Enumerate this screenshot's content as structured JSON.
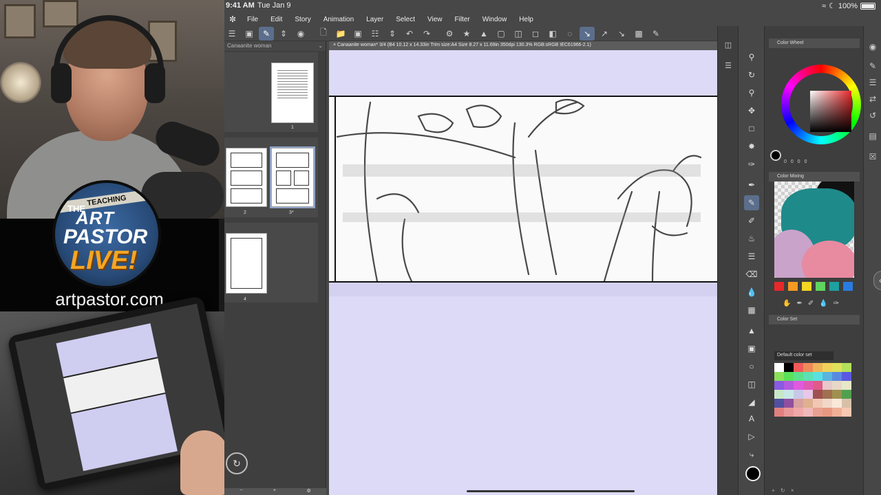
{
  "promo": {
    "logo_top": "TEACHING",
    "logo_line1": "THE",
    "logo_line2": "ART",
    "logo_line3": "PASTOR",
    "logo_line4": "LIVE!",
    "url": "artpastor.com"
  },
  "status_bar": {
    "time": "9:41 AM",
    "date": "Tue Jan 9",
    "wifi_icon": "wifi-icon",
    "battery": "100%"
  },
  "menu": {
    "items": [
      "File",
      "Edit",
      "Story",
      "Animation",
      "Layer",
      "Select",
      "View",
      "Filter",
      "Window",
      "Help"
    ]
  },
  "page_manager": {
    "title": "Canaanite woman",
    "pages": [
      {
        "label": "1"
      },
      {
        "label": "2"
      },
      {
        "label": "3*"
      },
      {
        "label": "4"
      }
    ]
  },
  "canvas": {
    "tab_title": "× Canaanite woman* 3/4 (B4 10.12 x 14.33in Trim size:A4 Size 8.27 x 11.69in 350dpi 130.3% RGB:sRGB IEC61966-2.1)"
  },
  "panels": {
    "color_wheel_title": "Color Wheel",
    "color_wheel_values": "0 0 0 0",
    "color_mixing_title": "Color Mixing",
    "color_set_title": "Color Set",
    "color_set_selected": "Default color set"
  },
  "colors": {
    "accent": "#5b6e8c",
    "canvas_bg": "#dcdaf7",
    "mix_swatches": [
      "#e8282a",
      "#f59a23",
      "#f5d623",
      "#5fd45f",
      "#1fa0a0",
      "#2a7be0"
    ],
    "color_set": [
      "#ffffff",
      "#000000",
      "#f05a5a",
      "#f08a5a",
      "#f0b45a",
      "#f0d25a",
      "#e0e05a",
      "#b4e05a",
      "#8ce05a",
      "#5ae05a",
      "#5ae08a",
      "#5ae0b4",
      "#5ae0e0",
      "#5ab4e0",
      "#5a8ae0",
      "#5a5ae0",
      "#8a5ae0",
      "#b45ae0",
      "#e05ae0",
      "#e05ab4",
      "#e05a8a",
      "#e8c8c8",
      "#e8d8c8",
      "#e8e8c8",
      "#c8e8c8",
      "#c8e8e8",
      "#c8c8e8",
      "#e8c8e8",
      "#a05050",
      "#a07050",
      "#a09050",
      "#50a050",
      "#5050a0",
      "#9050a0",
      "#d8a0a0",
      "#e0b090",
      "#f0c8b4",
      "#f0d8c8",
      "#f8e8d8",
      "#d8c0a8",
      "#e08080",
      "#e89898",
      "#f0a8a8",
      "#f0b8b8",
      "#e8a090",
      "#e89880",
      "#f0b098",
      "#f8c8b0"
    ]
  }
}
